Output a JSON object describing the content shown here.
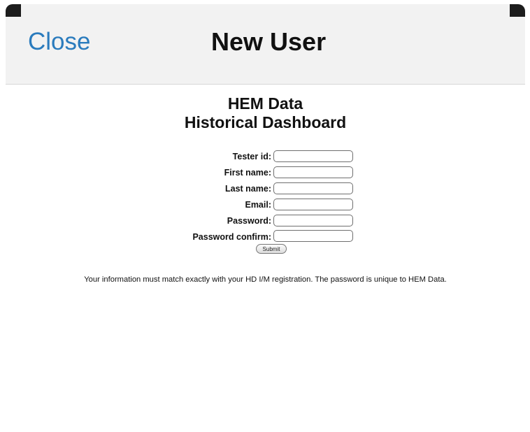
{
  "navbar": {
    "close_label": "Close",
    "title": "New User"
  },
  "page": {
    "heading_line1": "HEM Data",
    "heading_line2": "Historical Dashboard"
  },
  "form": {
    "fields": [
      {
        "label": "Tester id:",
        "value": "",
        "placeholder": ""
      },
      {
        "label": "First name:",
        "value": "",
        "placeholder": ""
      },
      {
        "label": "Last name:",
        "value": "",
        "placeholder": ""
      },
      {
        "label": "Email:",
        "value": "",
        "placeholder": ""
      },
      {
        "label": "Password:",
        "value": "",
        "placeholder": ""
      },
      {
        "label": "Password confirm:",
        "value": "",
        "placeholder": ""
      }
    ],
    "submit_label": "Submit"
  },
  "note": "Your information must match exactly with your HD I/M registration. The password is unique to HEM Data."
}
